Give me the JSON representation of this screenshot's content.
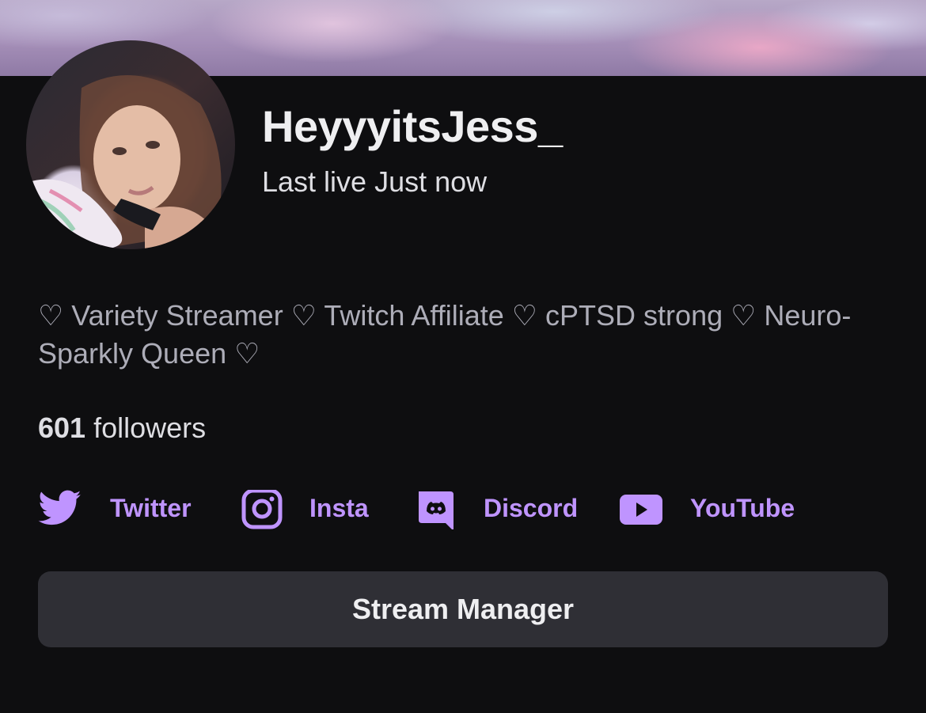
{
  "profile": {
    "username": "HeyyyitsJess_",
    "last_live": "Last live Just now",
    "bio": "♡ Variety Streamer ♡ Twitch Affiliate ♡ cPTSD strong ♡ Neuro-Sparkly Queen ♡",
    "followers_count": "601",
    "followers_label": " followers"
  },
  "socials": [
    {
      "label": "Twitter",
      "icon": "twitter-bird-icon"
    },
    {
      "label": "Insta",
      "icon": "instagram-icon"
    },
    {
      "label": "Discord",
      "icon": "discord-icon"
    },
    {
      "label": "YouTube",
      "icon": "youtube-icon"
    }
  ],
  "actions": {
    "stream_manager_label": "Stream Manager"
  },
  "colors": {
    "background": "#0e0e10",
    "accent": "#bf94ff",
    "button_bg": "#2f2f35",
    "muted_text": "#adadb8"
  }
}
